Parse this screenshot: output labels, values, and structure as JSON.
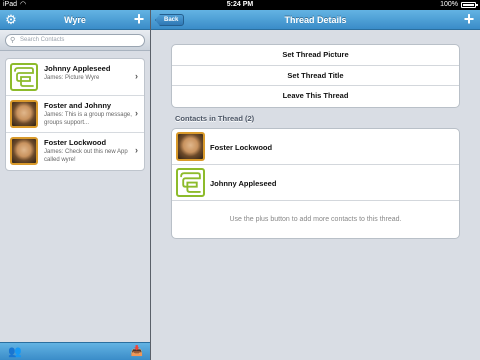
{
  "status_bar": {
    "carrier": "iPad",
    "time": "5:24 PM",
    "battery": "100%"
  },
  "left_pane": {
    "title": "Wyre",
    "search": {
      "placeholder": "Search Contacts"
    },
    "conversations": [
      {
        "name": "Johnny Appleseed",
        "preview": "James: Picture Wyre",
        "avatar": "app-logo"
      },
      {
        "name": "Foster and Johnny",
        "preview": "James: This is a group message, groups support...",
        "avatar": "person-photo"
      },
      {
        "name": "Foster Lockwood",
        "preview": "James: Check out this new App called wyre!",
        "avatar": "person-photo"
      }
    ],
    "toolbar_icons": [
      "people-icon",
      "inbox-tray-icon"
    ]
  },
  "right_pane": {
    "back_label": "Back",
    "title": "Thread Details",
    "actions": [
      "Set Thread Picture",
      "Set Thread Title",
      "Leave This Thread"
    ],
    "contacts_header": "Contacts in Thread (2)",
    "contacts": [
      {
        "name": "Foster Lockwood",
        "avatar": "person-photo"
      },
      {
        "name": "Johnny Appleseed",
        "avatar": "app-logo"
      }
    ],
    "hint": "Use the plus button to add more contacts to this thread."
  },
  "colors": {
    "nav_bar": "#3a8cc8",
    "background": "#d9dde4",
    "logo_border": "#8dbb2b",
    "photo_border": "#d99a2b"
  }
}
